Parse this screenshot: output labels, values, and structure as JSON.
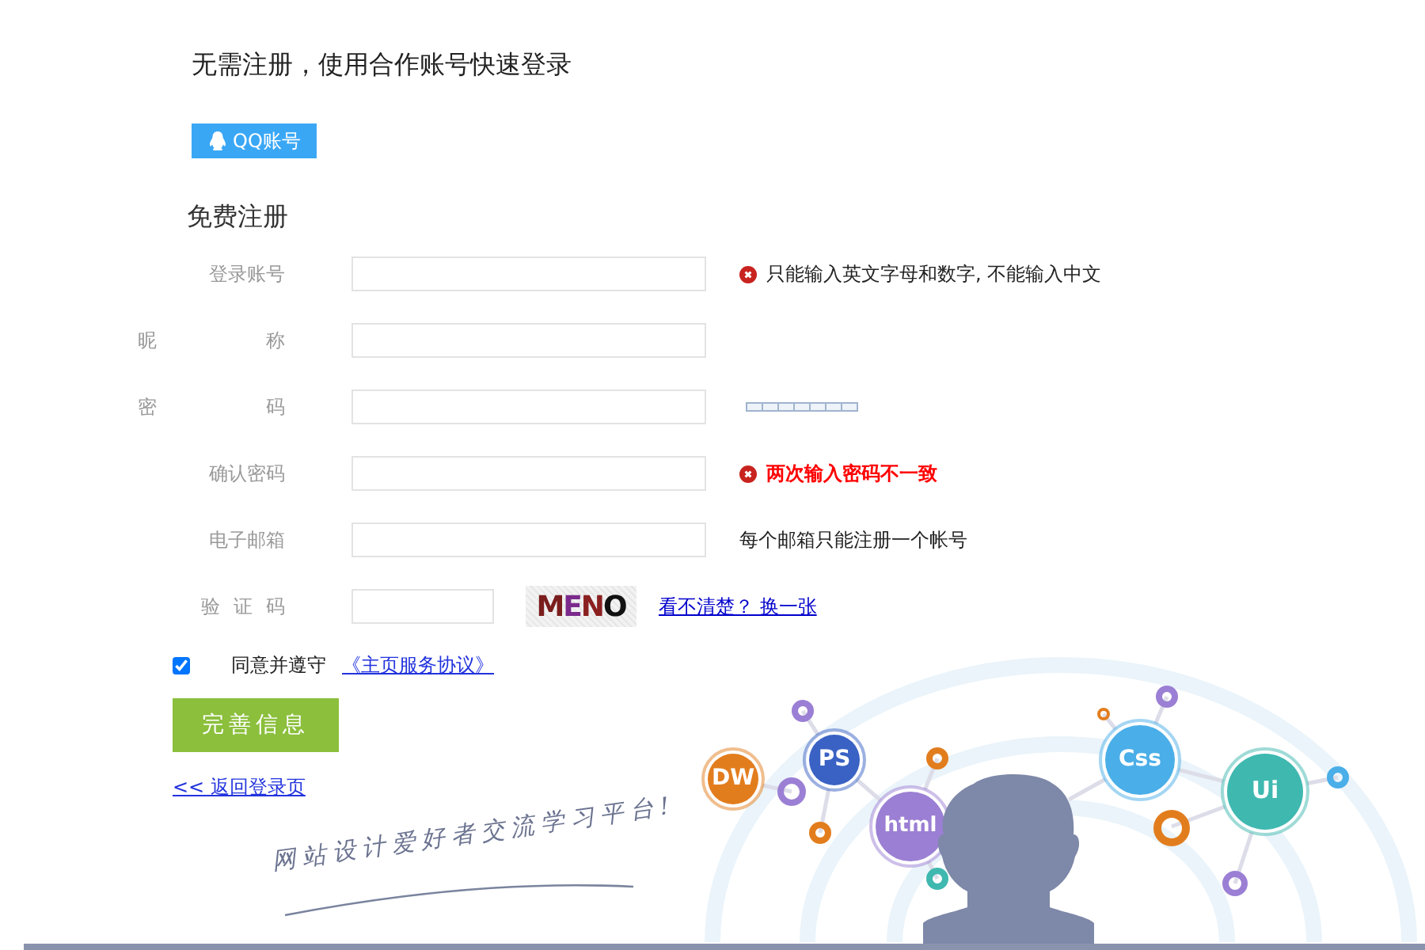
{
  "social_login": {
    "title": "无需注册，使用合作账号快速登录",
    "buttons": [
      {
        "label": "QQ账号"
      }
    ]
  },
  "register": {
    "title": "免费注册",
    "fields": [
      {
        "label": "登录账号",
        "kind": "text",
        "hint": {
          "kind": "warning",
          "text": "只能输入英文字母和数字, 不能输入中文"
        }
      },
      {
        "label": "昵称",
        "kind": "text"
      },
      {
        "label": "密码",
        "kind": "password",
        "strength": {
          "level": 0
        }
      },
      {
        "label": "确认密码",
        "kind": "text",
        "hint": {
          "kind": "error",
          "text": "两次输入密码不一致"
        }
      },
      {
        "label": "电子邮箱",
        "kind": "text",
        "hint": {
          "kind": "note",
          "text": "每个邮箱只能注册一个帐号"
        }
      },
      {
        "label": "验证码",
        "kind": "captcha",
        "captcha": "MENO",
        "link": "看不清楚？ 换一张"
      }
    ],
    "agreement": {
      "checked": true,
      "text": "同意并遵守",
      "link": "《主页服务协议》"
    },
    "submit": "完善信息",
    "back_link": "<< 返回登录页"
  },
  "illustration": {
    "tagline": "网站设计爱好者交流学习平台!",
    "badges": [
      {
        "label": "DW",
        "color": "#e27d1e"
      },
      {
        "label": "PS",
        "color": "#3a62c4"
      },
      {
        "label": "html",
        "color": "#9b7fd4"
      },
      {
        "label": "Css",
        "color": "#4aaee8"
      },
      {
        "label": "Ui",
        "color": "#3fb8b0"
      }
    ]
  }
}
